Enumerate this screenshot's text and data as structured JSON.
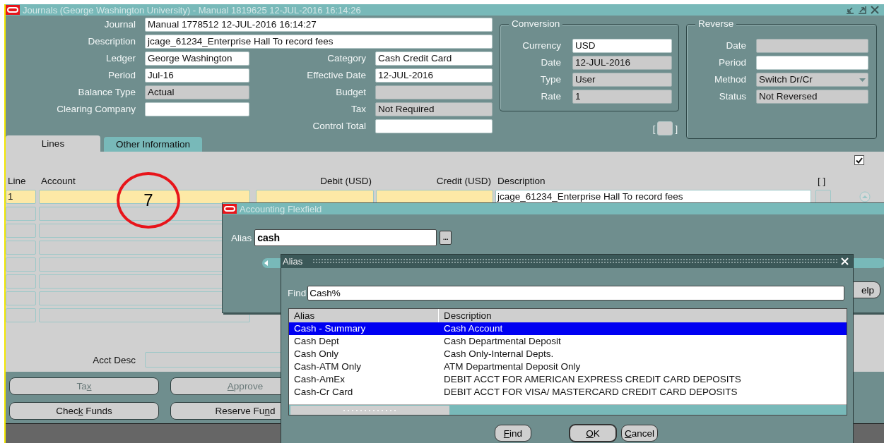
{
  "window": {
    "title": "Journals (George Washington University) - Manual 1819625 12-JUL-2016 16:14:26"
  },
  "header": {
    "rows": [
      {
        "wide": {
          "label": "Journal",
          "value": "Manual 1778512 12-JUL-2016 16:14:27",
          "disabled": false
        }
      },
      {
        "wide": {
          "label": "Description",
          "value": "jcage_61234_Enterprise Hall   To record fees",
          "disabled": false
        }
      },
      {
        "left": {
          "label": "Ledger",
          "value": "George Washington",
          "disabled": false
        },
        "right": {
          "label": "Category",
          "value": "Cash Credit Card",
          "disabled": false
        }
      },
      {
        "left": {
          "label": "Period",
          "value": "Jul-16",
          "disabled": false
        },
        "right": {
          "label": "Effective Date",
          "value": "12-JUL-2016",
          "disabled": false
        }
      },
      {
        "left": {
          "label": "Balance Type",
          "value": "Actual",
          "disabled": true
        },
        "right": {
          "label": "Budget",
          "disabled": true
        }
      },
      {
        "left": {
          "label": "Clearing Company",
          "disabled": false
        },
        "right": {
          "label": "Tax",
          "value": "Not Required",
          "disabled": true
        }
      },
      {
        "right": {
          "label": "Control Total",
          "disabled": false
        }
      }
    ]
  },
  "conversion": {
    "title": "Conversion",
    "fields": [
      {
        "label": "Currency",
        "value": "USD",
        "disabled": false
      },
      {
        "label": "Date",
        "value": "12-JUL-2016",
        "disabled": true
      },
      {
        "label": "Type",
        "value": "User",
        "disabled": true
      },
      {
        "label": "Rate",
        "value": "1",
        "disabled": true
      }
    ]
  },
  "bracket_box": {
    "open": "[",
    "close": "]",
    "checked": false
  },
  "reverse": {
    "title": "Reverse",
    "fields": [
      {
        "label": "Date",
        "disabled": true,
        "kind": "text"
      },
      {
        "label": "Period",
        "disabled": false,
        "kind": "text"
      },
      {
        "label": "Method",
        "value": "Switch Dr/Cr",
        "disabled": true,
        "kind": "dropdown"
      },
      {
        "label": "Status",
        "value": "Not Reversed",
        "disabled": true,
        "kind": "text"
      }
    ]
  },
  "tabs": [
    {
      "label": "Lines",
      "selected": true
    },
    {
      "label": "Other Information",
      "selected": false
    }
  ],
  "lines": {
    "checked": true,
    "columns": [
      "Line",
      "Account",
      "Debit (USD)",
      "Credit (USD)",
      "Description",
      "[ ]"
    ],
    "rows": [
      {
        "line": "1",
        "description": "jcage_61234_Enterprise Hall   To record fees",
        "selected": true
      }
    ],
    "acct_desc_label": "Acct Desc"
  },
  "buttons": [
    [
      {
        "before": "Ta",
        "key": "x",
        "disabled": true
      },
      {
        "key": "A",
        "after": "pprove",
        "disabled": true
      }
    ],
    [
      {
        "before": "Chec",
        "key": "k",
        "after": " Funds",
        "disabled": false
      },
      {
        "before": "Reserve Fu",
        "key": "n",
        "after": "d",
        "disabled": false
      }
    ]
  ],
  "annotation": "7",
  "flexfield": {
    "title": "Accounting Flexfield",
    "alias_label": "Alias",
    "alias_value": "cash",
    "lov_button": "...",
    "help_button": "elp"
  },
  "alias_dialog": {
    "title": "Alias",
    "find_label": "Find",
    "find_value": "Cash%",
    "columns": [
      "Alias",
      "Description"
    ],
    "rows": [
      {
        "alias": "Cash - Summary",
        "description": "Cash Account",
        "selected": true
      },
      {
        "alias": "Cash Dept",
        "description": "Cash Departmental Deposit",
        "selected": false
      },
      {
        "alias": "Cash Only",
        "description": "Cash Only-Internal Depts.",
        "selected": false
      },
      {
        "alias": "Cash-ATM Only",
        "description": "ATM Departmental Deposit Only",
        "selected": false
      },
      {
        "alias": "Cash-AmEx",
        "description": "DEBIT ACCT FOR AMERICAN EXPRESS CREDIT CARD DEPOSITS",
        "selected": false
      },
      {
        "alias": "Cash-Cr Card",
        "description": "DEBIT ACCT FOR VISA/ MASTERCARD CREDIT CARD DEPOSITS",
        "selected": false
      }
    ],
    "buttons": [
      {
        "key": "F",
        "after": "ind",
        "default": false
      },
      {
        "key": "O",
        "after": "K",
        "default": true
      },
      {
        "key": "C",
        "after": "ancel",
        "default": false
      }
    ]
  }
}
